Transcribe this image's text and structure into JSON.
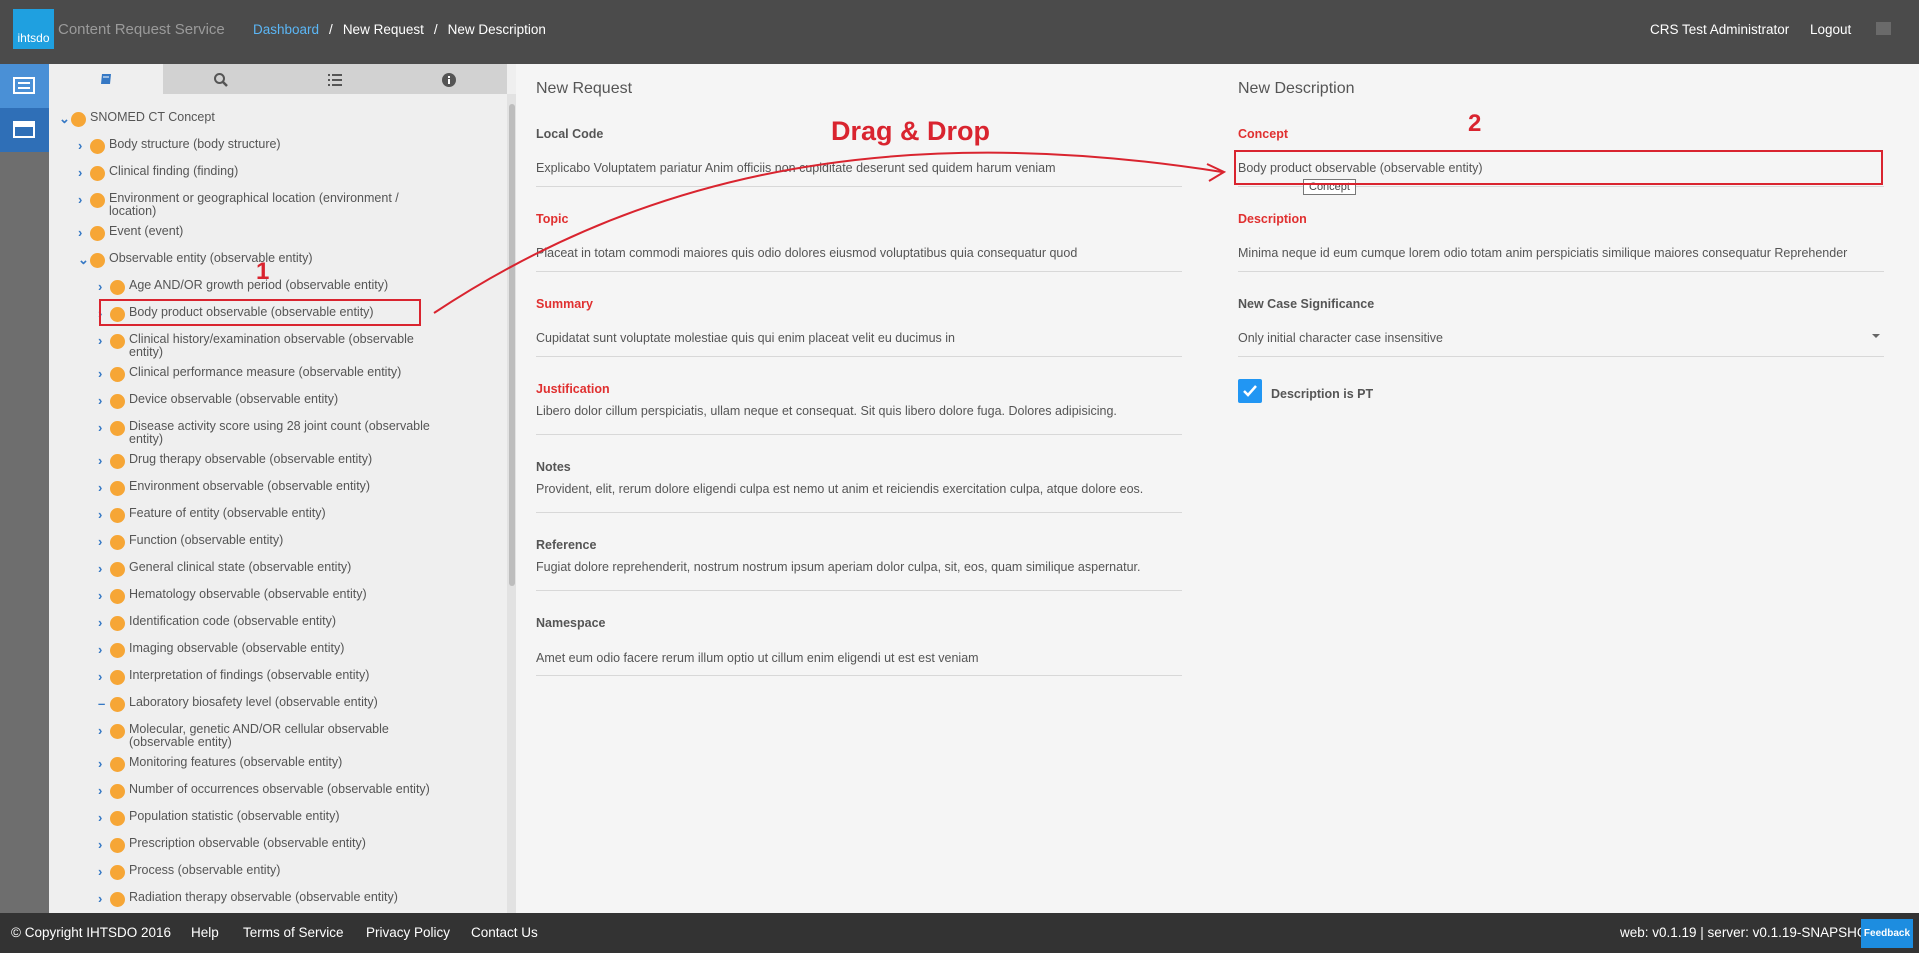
{
  "header": {
    "logo_text": "ihtsdo",
    "app_title": "Content Request Service",
    "breadcrumbs": [
      "Dashboard",
      "New Request",
      "New Description"
    ],
    "user_name": "CRS Test Administrator",
    "logout_label": "Logout"
  },
  "rail": {
    "icons": [
      "list-icon",
      "window-icon"
    ]
  },
  "tree_tabs": [
    "book-icon",
    "search-icon",
    "numbered-list-icon",
    "info-icon"
  ],
  "tree": {
    "root": "SNOMED CT Concept",
    "nodes": [
      "Body structure (body structure)",
      "Clinical finding (finding)",
      "Environment or geographical location (environment / location)",
      "Event (event)",
      "Observable entity (observable entity)",
      "Age AND/OR growth period (observable entity)",
      "Body product observable (observable entity)",
      "Clinical history/examination observable (observable entity)",
      "Clinical performance measure (observable entity)",
      "Device observable (observable entity)",
      "Disease activity score using 28 joint count (observable entity)",
      "Drug therapy observable (observable entity)",
      "Environment observable (observable entity)",
      "Feature of entity (observable entity)",
      "Function (observable entity)",
      "General clinical state (observable entity)",
      "Hematology observable (observable entity)",
      "Identification code (observable entity)",
      "Imaging observable (observable entity)",
      "Interpretation of findings (observable entity)",
      "Laboratory biosafety level (observable entity)",
      "Molecular, genetic AND/OR cellular observable (observable entity)",
      "Monitoring features (observable entity)",
      "Number of occurrences observable (observable entity)",
      "Population statistic (observable entity)",
      "Prescription observable (observable entity)",
      "Process (observable entity)",
      "Radiation therapy observable (observable entity)"
    ]
  },
  "annotations": {
    "marker1": "1",
    "marker2": "2",
    "drag_drop": "Drag & Drop"
  },
  "new_request": {
    "title": "New Request",
    "fields": [
      {
        "label": "Local Code",
        "value": "Explicabo Voluptatem pariatur Anim officiis non cupiditate deserunt sed quidem harum veniam"
      },
      {
        "label": "Topic",
        "value": "Placeat in totam commodi maiores quis odio dolores eiusmod voluptatibus quia consequatur quod"
      },
      {
        "label": "Summary",
        "value": "Cupidatat sunt voluptate molestiae quis qui enim placeat velit eu ducimus in"
      },
      {
        "label": "Justification",
        "value": "Libero dolor cillum perspiciatis, ullam neque et consequat. Sit quis libero dolore fuga. Dolores adipisicing."
      },
      {
        "label": "Notes",
        "value": "Provident, elit, rerum dolore eligendi culpa est nemo ut anim et reiciendis exercitation culpa, atque dolore eos."
      },
      {
        "label": "Reference",
        "value": "Fugiat dolore reprehenderit, nostrum nostrum ipsum aperiam dolor culpa, sit, eos, quam similique aspernatur."
      },
      {
        "label": "Namespace",
        "value": "Amet eum odio facere rerum illum optio ut cillum enim eligendi ut est est veniam"
      }
    ]
  },
  "new_description": {
    "title": "New Description",
    "concept_label": "Concept",
    "concept_value": "Body product observable (observable entity)",
    "concept_tooltip": "Concept",
    "description_label": "Description",
    "description_value": "Minima neque id eum cumque lorem odio totam anim perspiciatis similique maiores consequatur Reprehender",
    "case_label": "New Case Significance",
    "case_value": "Only initial character case insensitive",
    "pt_label": "Description is PT",
    "pt_checked": true
  },
  "footer": {
    "copyright": "© Copyright IHTSDO 2016",
    "links": [
      "Help",
      "Terms of Service",
      "Privacy Policy",
      "Contact Us"
    ],
    "version": "web: v0.1.19 | server: v0.1.19-SNAPSHOT",
    "feedback": "Feedback"
  },
  "colors": {
    "accent": "#2196f3",
    "annotation_red": "#d9242f",
    "node_dot": "#f6a636",
    "header_bg": "#4b4b4b"
  }
}
